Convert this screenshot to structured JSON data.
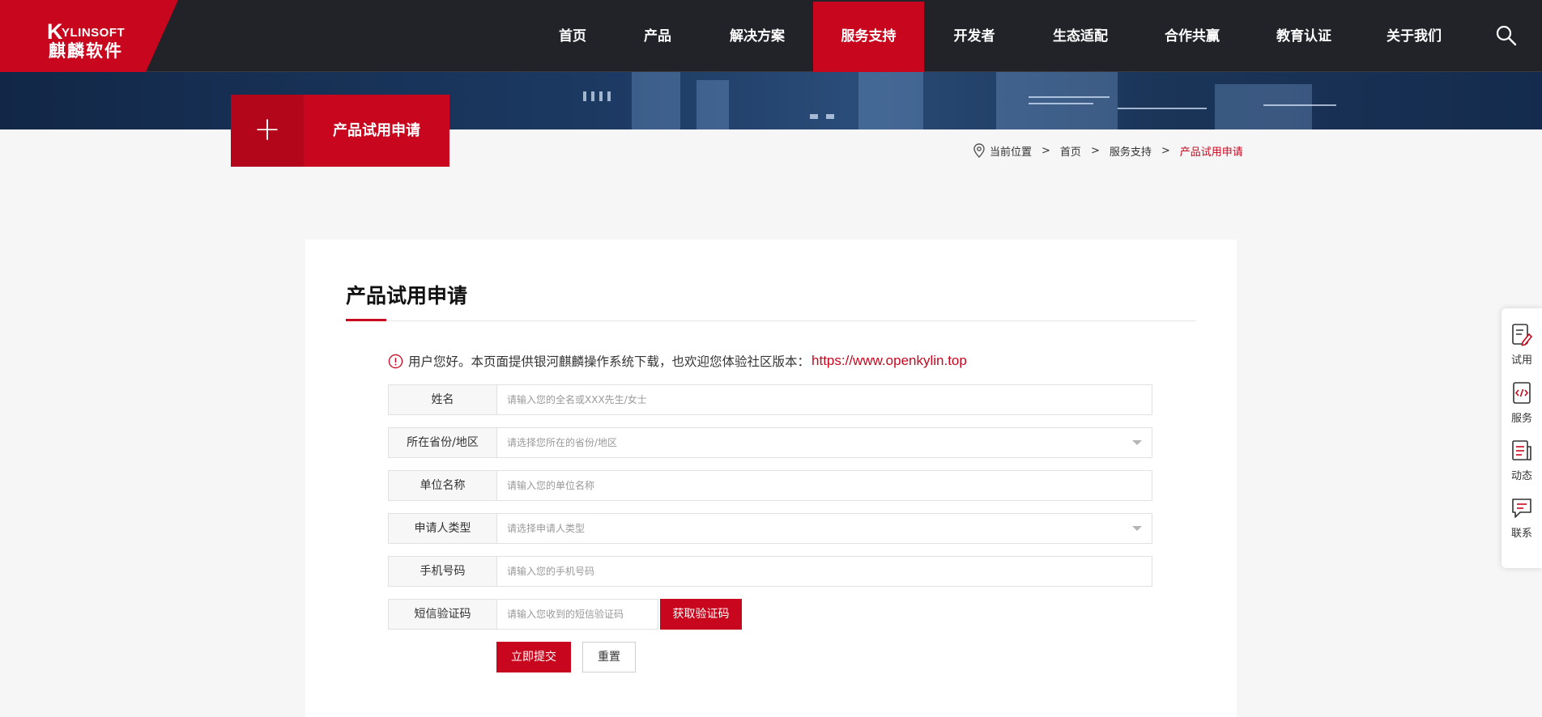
{
  "header": {
    "logo_en_k": "K",
    "logo_en_rest": "YLINSOFT",
    "logo_cn": "麒麟软件",
    "nav": [
      {
        "label": "首页"
      },
      {
        "label": "产品"
      },
      {
        "label": "解决方案"
      },
      {
        "label": "服务支持",
        "active": true
      },
      {
        "label": "开发者"
      },
      {
        "label": "生态适配"
      },
      {
        "label": "合作共赢"
      },
      {
        "label": "教育认证"
      },
      {
        "label": "关于我们"
      }
    ],
    "search_icon": "search-icon"
  },
  "section_tab": {
    "plus": "+",
    "title": "产品试用申请"
  },
  "breadcrumb": {
    "prefix": "当前位置",
    "items": [
      "首页",
      "服务支持"
    ],
    "current": "产品试用申请",
    "separator": ">"
  },
  "form": {
    "title": "产品试用申请",
    "notice_text": "用户您好。本页面提供银河麒麟操作系统下载，也欢迎您体验社区版本：",
    "notice_link": "https://www.openkylin.top",
    "fields": [
      {
        "label": "姓名",
        "placeholder": "请输入您的全名或XXX先生/女士"
      },
      {
        "label": "所在省份/地区",
        "placeholder": "请选择您所在的省份/地区"
      },
      {
        "label": "单位名称",
        "placeholder": "请输入您的单位名称"
      },
      {
        "label": "申请人类型",
        "placeholder": "请选择申请人类型"
      },
      {
        "label": "手机号码",
        "placeholder": "请输入您的手机号码"
      },
      {
        "label": "短信验证码",
        "placeholder": "请输入您收到的短信验证码"
      }
    ],
    "get_code": "获取验证码",
    "submit": "立即提交",
    "reset": "重置"
  },
  "sidebar": [
    {
      "label": "试用",
      "icon": "trial-icon"
    },
    {
      "label": "服务",
      "icon": "service-code-icon"
    },
    {
      "label": "动态",
      "icon": "news-icon"
    },
    {
      "label": "联系",
      "icon": "contact-chat-icon"
    }
  ],
  "colors": {
    "brand_red": "#c8071e",
    "header_bg": "#212329"
  }
}
